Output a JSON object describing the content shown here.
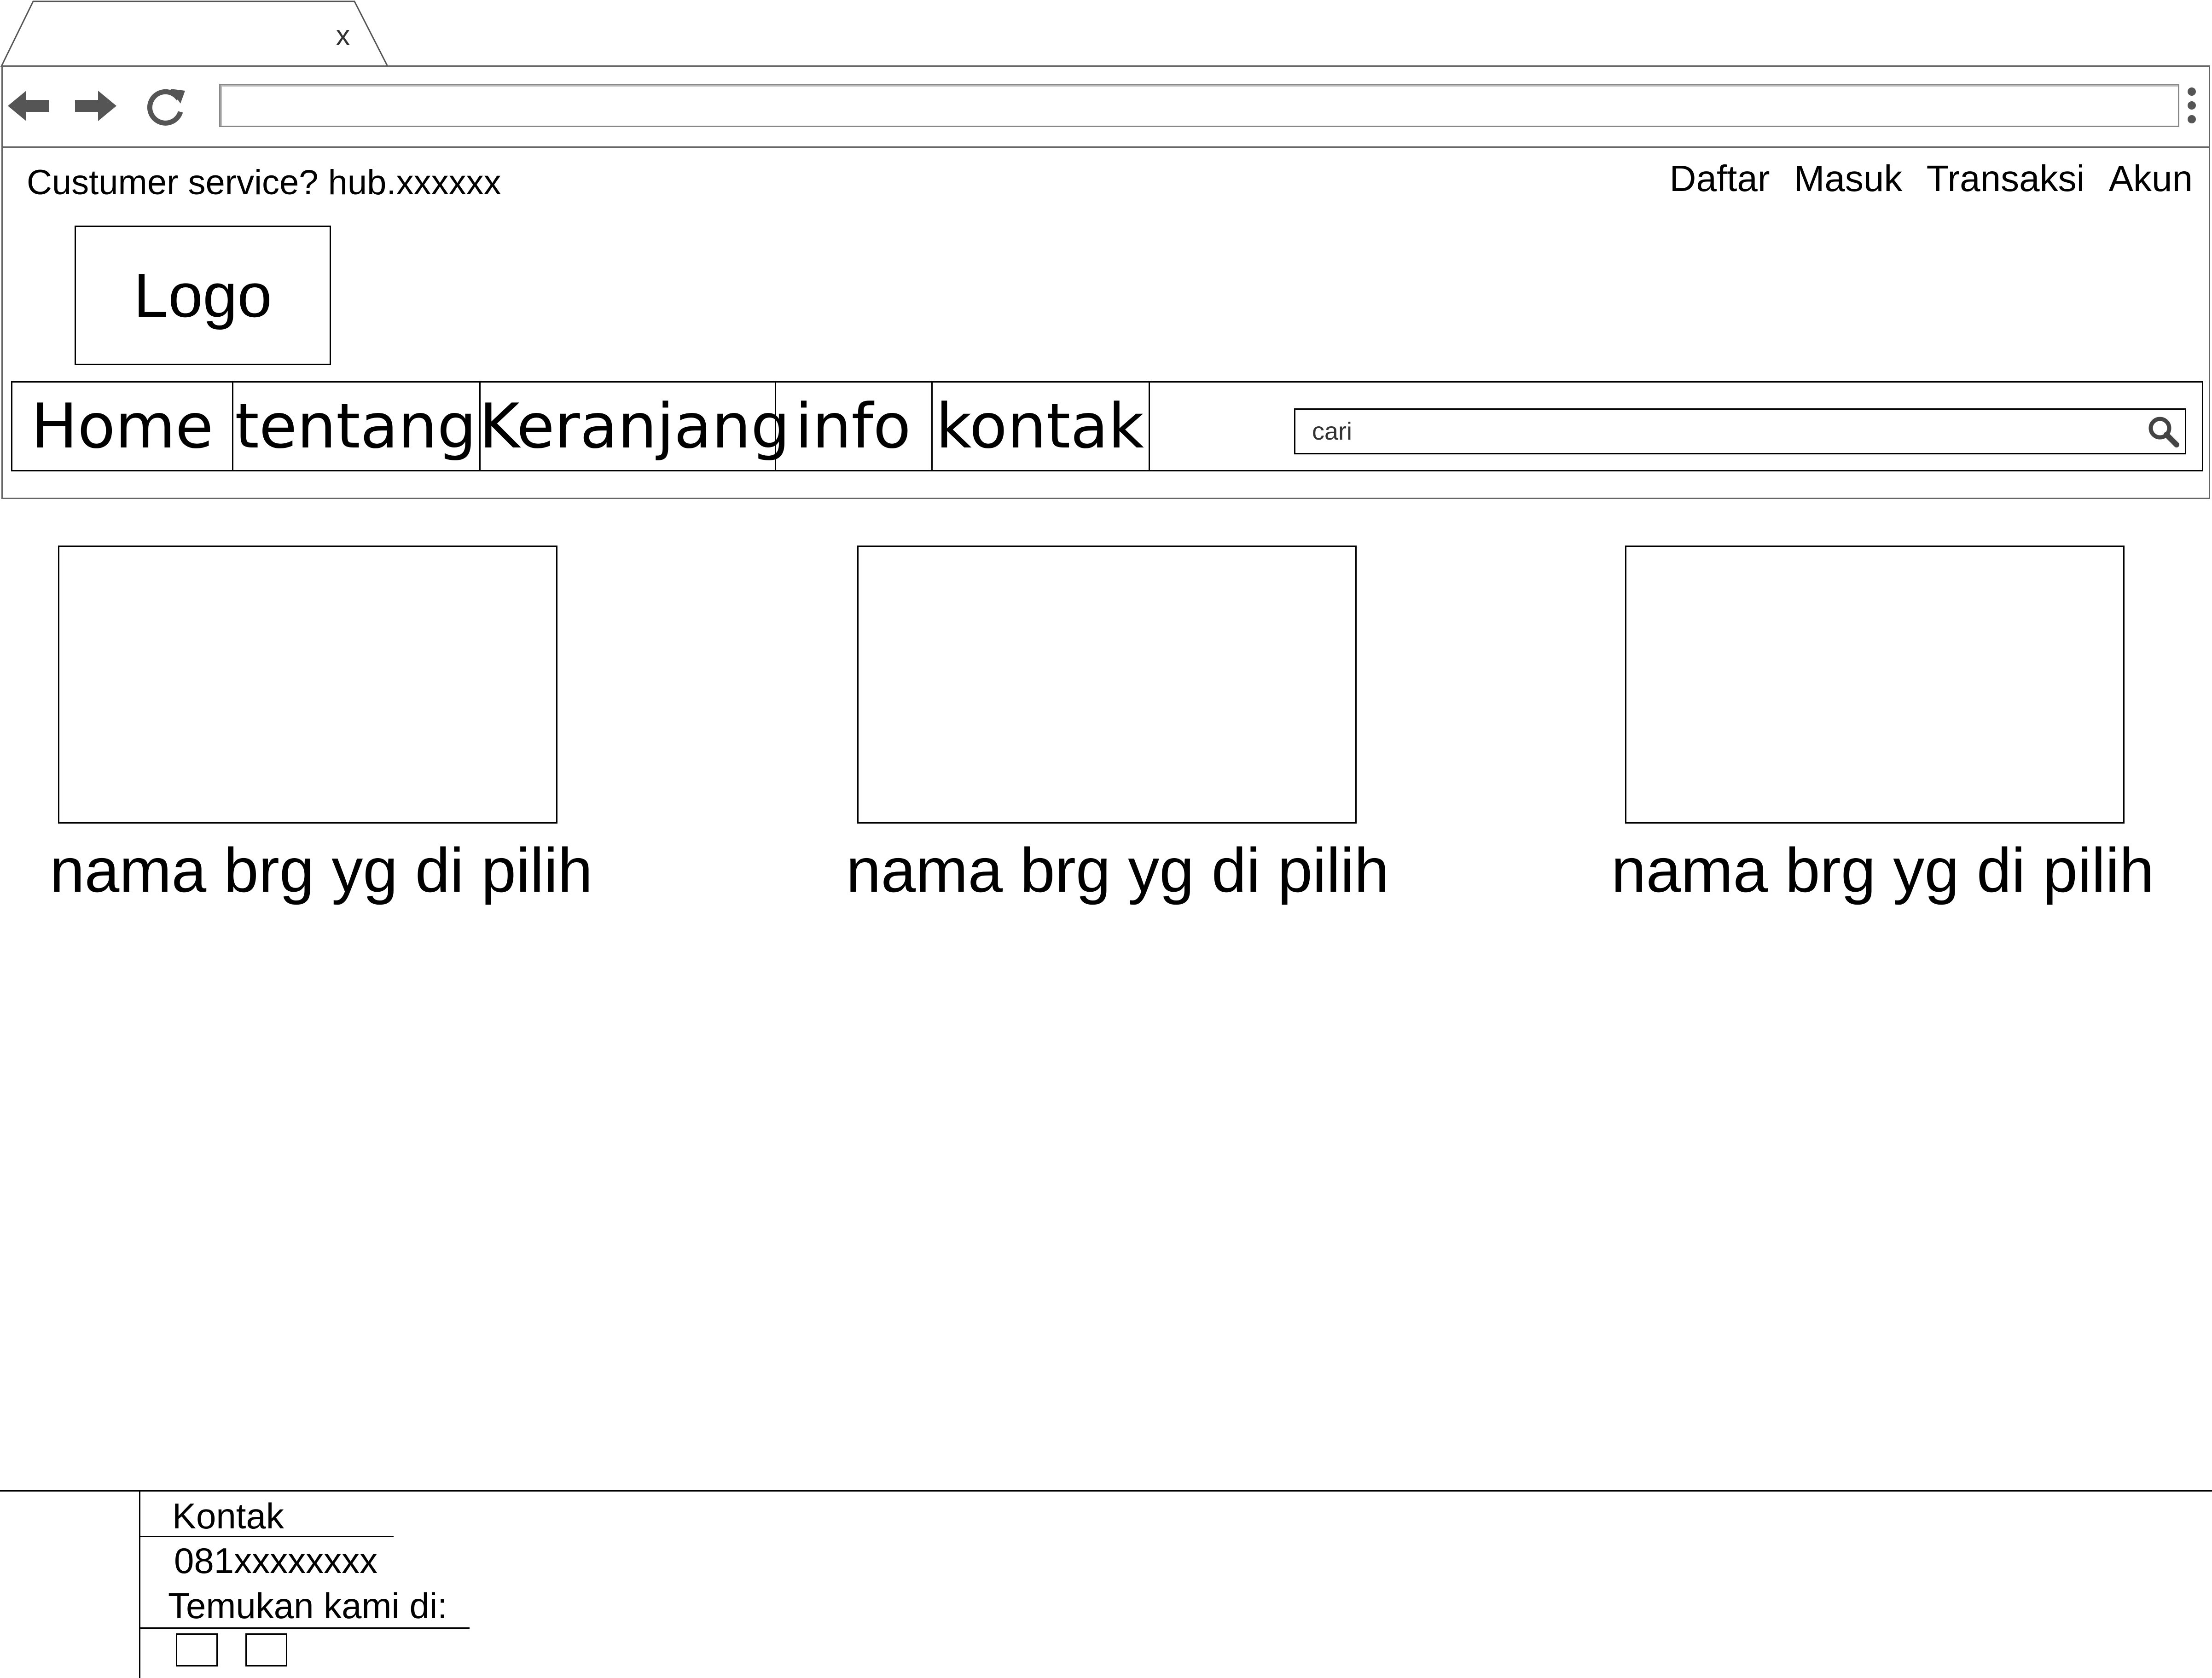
{
  "browser": {
    "tab_close": "x",
    "url": ""
  },
  "top_bar": {
    "customer_service": "Custumer service? hub.xxxxxx",
    "links": [
      "Daftar",
      "Masuk",
      "Transaksi",
      "Akun"
    ]
  },
  "logo": {
    "label": "Logo"
  },
  "nav": {
    "items": [
      "Home",
      "tentang",
      "Keranjang",
      "info",
      "kontak"
    ]
  },
  "search": {
    "placeholder": "cari"
  },
  "products": [
    {
      "name": "nama brg yg di pilih"
    },
    {
      "name": "nama brg yg di pilih"
    },
    {
      "name": "nama brg yg di pilih"
    }
  ],
  "footer": {
    "kontak_title": "Kontak",
    "phone": "081xxxxxxxx",
    "find_us": "Temukan kami di:"
  },
  "colors": {
    "chrome_gray": "#555555",
    "border": "#000000"
  }
}
